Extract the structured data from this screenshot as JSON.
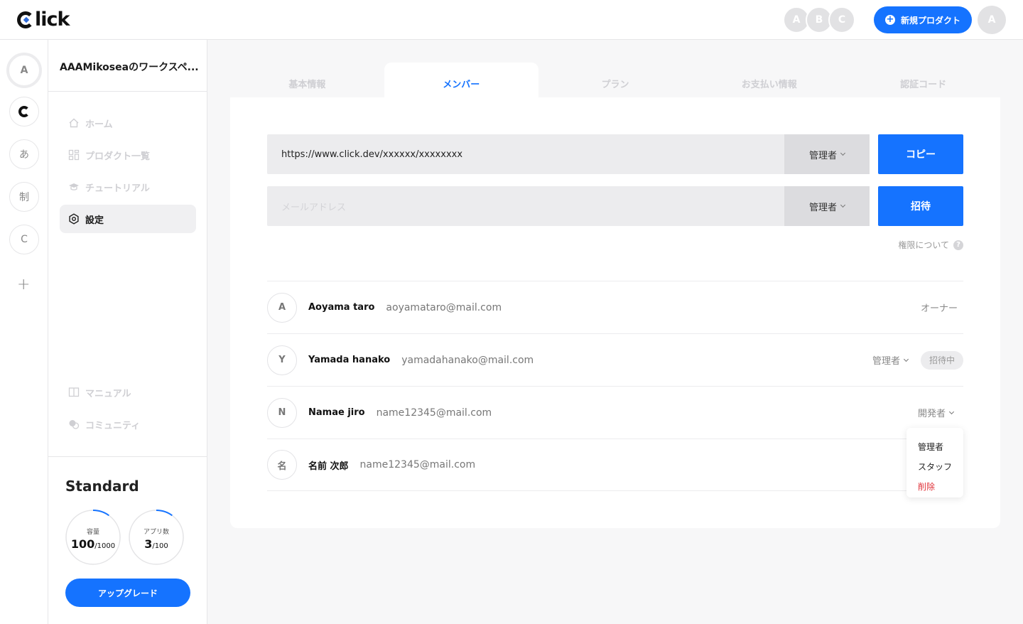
{
  "app": {
    "logo_text": "lick"
  },
  "header": {
    "presence": [
      "A",
      "B",
      "C"
    ],
    "new_project_label": "新規プロダクト",
    "user_initial": "A"
  },
  "workspaces": [
    "A",
    "あ",
    "制",
    "C"
  ],
  "sidebar": {
    "workspace_title": "AAAMikoseaのワークスペ...",
    "items": [
      {
        "label": "ホーム",
        "icon": "home-icon"
      },
      {
        "label": "プロダクト一覧",
        "icon": "grid-icon"
      },
      {
        "label": "チュートリアル",
        "icon": "graduation-cap-icon"
      },
      {
        "label": "設定",
        "icon": "gear-icon"
      }
    ],
    "bottom_items": [
      {
        "label": "マニュアル",
        "icon": "book-icon"
      },
      {
        "label": "コミュニティ",
        "icon": "chat-icon"
      }
    ],
    "plan": {
      "name": "Standard",
      "storage": {
        "label": "容量",
        "value": "100",
        "max": "/1000",
        "fraction": 0.1
      },
      "apps": {
        "label": "アプリ数",
        "value": "3",
        "max": "/100",
        "fraction": 0.03
      },
      "upgrade_label": "アップグレード"
    }
  },
  "tabs": [
    "基本情報",
    "メンバー",
    "プラン",
    "お支払い情報",
    "認証コード"
  ],
  "invite": {
    "link_url": "https://www.click.dev/xxxxxx/xxxxxxxx",
    "link_role": "管理者",
    "copy_label": "コピー",
    "email_placeholder": "メールアドレス",
    "email_role": "管理者",
    "invite_label": "招待",
    "permissions_link": "権限について"
  },
  "members": [
    {
      "initial": "A",
      "name": "Aoyama taro",
      "email": "aoyamataro@mail.com",
      "role": "オーナー",
      "badge": ""
    },
    {
      "initial": "Y",
      "name": "Yamada hanako",
      "email": "yamadahanako@mail.com",
      "role": "管理者",
      "badge": "招待中"
    },
    {
      "initial": "N",
      "name": "Namae jiro",
      "email": "name12345@mail.com",
      "role": "開発者",
      "badge": ""
    },
    {
      "initial": "名",
      "name": "名前 次郎",
      "email": "name12345@mail.com",
      "role": "",
      "badge": ""
    }
  ],
  "role_dropdown": [
    "管理者",
    "スタッフ",
    "削除"
  ],
  "colors": {
    "primary": "#1573ff",
    "danger": "#e0333a"
  }
}
